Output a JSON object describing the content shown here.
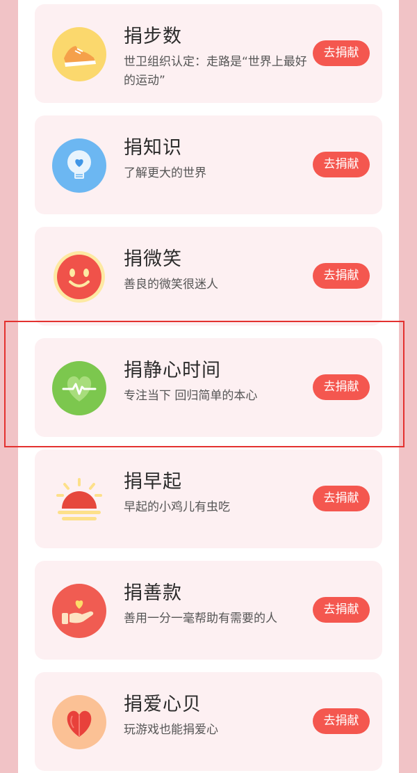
{
  "cards": [
    {
      "title": "捐步数",
      "desc": "世卫组织认定：走路是“世界上最好的运动”",
      "button": "去捐献",
      "icon": "sneaker-icon",
      "icon_bg": "#fbd86d"
    },
    {
      "title": "捐知识",
      "desc": "了解更大的世界",
      "button": "去捐献",
      "icon": "lightbulb-heart-icon",
      "icon_bg": "#6cb7f2"
    },
    {
      "title": "捐微笑",
      "desc": "善良的微笑很迷人",
      "button": "去捐献",
      "icon": "smiley-icon",
      "icon_bg": "#f0524a"
    },
    {
      "title": "捐静心时间",
      "desc": "专注当下 回归简单的本心",
      "button": "去捐献",
      "icon": "heartbeat-icon",
      "icon_bg": "#7cc74e"
    },
    {
      "title": "捐早起",
      "desc": "早起的小鸡儿有虫吃",
      "button": "去捐献",
      "icon": "sunrise-icon",
      "icon_bg": "#e6473d"
    },
    {
      "title": "捐善款",
      "desc": "善用一分一毫帮助有需要的人",
      "button": "去捐献",
      "icon": "hand-heart-icon",
      "icon_bg": "#f05c52"
    },
    {
      "title": "捐爱心贝",
      "desc": "玩游戏也能捐爱心",
      "button": "去捐献",
      "icon": "heart-shell-icon",
      "icon_bg": "#fbc195"
    }
  ],
  "highlight_color": "#e3312f",
  "accent": "#f4574f"
}
